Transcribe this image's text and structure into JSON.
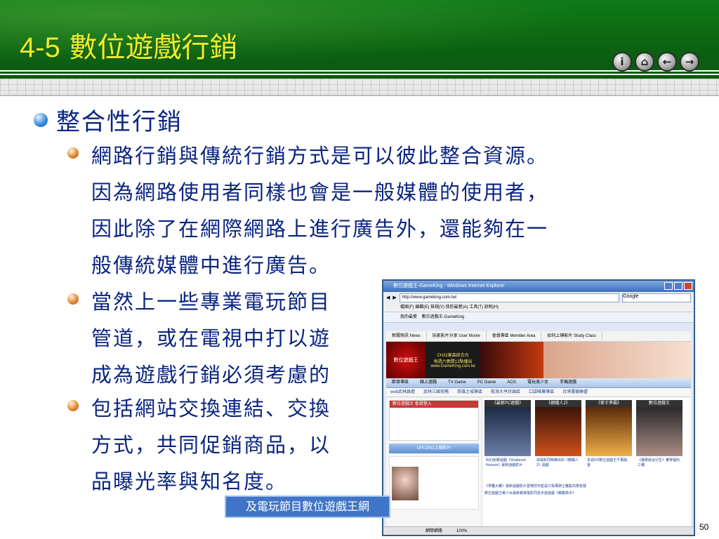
{
  "slide": {
    "title_num": "4-5",
    "title_text": "數位遊戲行銷",
    "page_number": "50",
    "colors": {
      "header_green": "#0c6a12",
      "title_yellow": "#f1ec2a",
      "body_blue": "#0a2480"
    }
  },
  "nav": {
    "info_label": "i",
    "home_label": "⌂",
    "prev_label": "←",
    "next_label": "→"
  },
  "bullets": {
    "level1": "整合性行銷",
    "items": [
      "網路行銷與傳統行銷方式是可以彼此整合資源。\n因為網路使用者同樣也會是一般媒體的使用者，\n因此除了在網際網路上進行廣告外，還能夠在一\n般傳統媒體中進行廣告。",
      "當然上一些專業電玩節目\n管道，或在電視中打以遊\n成為遊戲行銷必須考慮的",
      "包括網站交換連結、交換\n方式，共同促銷商品，以\n品曝光率與知名度。"
    ]
  },
  "browser": {
    "window_title": "數位遊戲王-GameKing - Windows Internet Explorer",
    "url": "http://www.gameking.com.tw/",
    "search_placeholder": "Google",
    "menu": "檔案(F)   編輯(E)   檢視(V)   我的最愛(A)   工具(T)   說明(H)",
    "tab": "數位遊戲王-GameKing",
    "favorites": "我的最愛",
    "status_zone": "網際網路",
    "zoom": "100%",
    "site": {
      "topnav": [
        "新聞快訊 News",
        "玩家影片分享 User Movie",
        "會員專區 Member Area",
        "如何上傳影片 Study Class"
      ],
      "logo_text": "數位遊戲王",
      "ad_line1": "CH32東森綜合台",
      "ad_line2": "每週六晚間12點播出",
      "ad_line3": "www.GameKing.com.tw",
      "navbar": [
        "節目專區",
        "線上遊戲",
        "TV Game",
        "PC Game",
        "ACG",
        "電玩美少女",
        "手機遊戲"
      ],
      "navbar2": [
        "web武林論壇",
        "武林三國攻略",
        "英雄之城專區",
        "航海大亨討論區",
        "口袋唯寶專區",
        "台灣電競聯盟"
      ],
      "login_header": "數位遊戲王 會員登入",
      "upload_label": "UPLOAD上傳影片",
      "cards": [
        {
          "header": "《最新PC遊戲》",
          "caption": "科幻射擊遊戲《Shattered Horizon》最新遊戲影片"
        },
        {
          "header": "《鋼鐵人2》",
          "caption": "與電影同時推出的《鋼鐵人2》遊戲"
        },
        {
          "header": "《拳王爭霸》",
          "caption": "本週XO數位遊戲王千萬獎金"
        },
        {
          "header": "數位遊戲王",
          "caption": "《優惠綜合衍生》實穿福利三種"
        }
      ],
      "news": [
        "《學蠶大賽》最新遊戲影片登場仿可趁是只有萬騎士雜亂的角色擂",
        "數位遊戲王美少女最新報導電影同名手遊遊戲《戰龍高手》"
      ]
    }
  },
  "caption": "及電玩節目數位遊戲王網"
}
